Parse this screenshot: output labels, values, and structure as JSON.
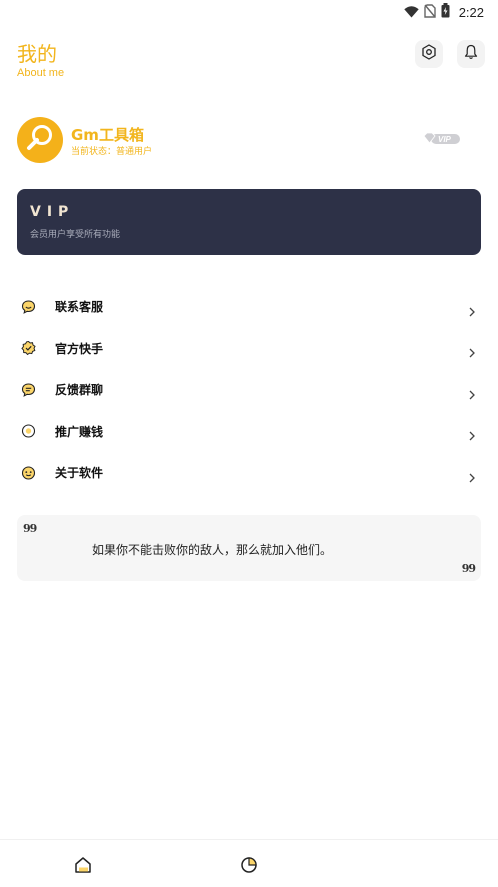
{
  "status_bar": {
    "time": "2:22",
    "icons": [
      "wifi-icon",
      "no-sim-icon",
      "battery-icon"
    ]
  },
  "header": {
    "title": "我的",
    "subtitle": "About me",
    "actions": [
      "settings-icon",
      "bell-icon"
    ]
  },
  "profile": {
    "name": "Gm工具箱",
    "status": "当前状态：普通用户",
    "badge": "VIP",
    "avatar_icon": "wrench-icon"
  },
  "vip_card": {
    "title": "VIP",
    "description": "会员用户享受所有功能"
  },
  "menu": {
    "items": [
      {
        "label": "联系客服",
        "icon": "chat-smile-icon"
      },
      {
        "label": "官方快手",
        "icon": "badge-check-icon"
      },
      {
        "label": "反馈群聊",
        "icon": "message-icon"
      },
      {
        "label": "推广赚钱",
        "icon": "coin-icon"
      },
      {
        "label": "关于软件",
        "icon": "info-face-icon"
      }
    ]
  },
  "quote": {
    "open_mark": "99",
    "text": "如果你不能击败你的敌人，那么就加入他们。",
    "close_mark": "99"
  },
  "bottom_nav": {
    "items": [
      {
        "name": "home",
        "icon": "home-icon"
      },
      {
        "name": "me",
        "icon": "profile-pie-icon"
      }
    ]
  },
  "colors": {
    "accent": "#f2b51d",
    "vip_card_bg": "#2d3147",
    "vip_title": "#f1e5d2",
    "quote_bg": "#f6f6f6"
  }
}
